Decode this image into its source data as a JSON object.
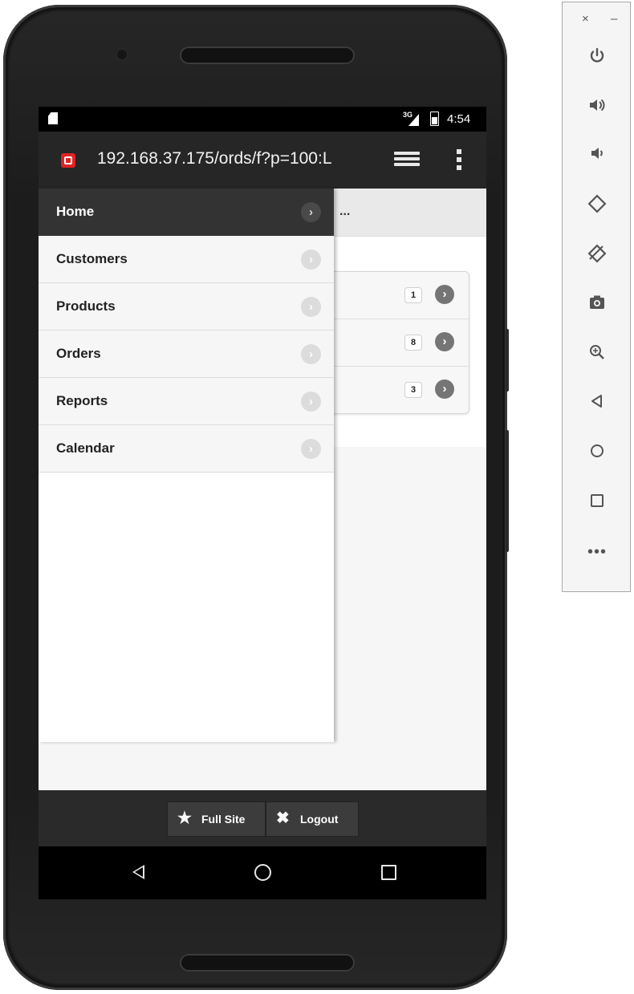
{
  "status_bar": {
    "network": "3G",
    "time": "4:54"
  },
  "browser": {
    "url": "192.168.37.175/ords/f?p=100:L"
  },
  "page": {
    "title_fragment": "..."
  },
  "list_counts": [
    "1",
    "8",
    "3"
  ],
  "nav_menu": [
    {
      "label": "Home",
      "active": true
    },
    {
      "label": "Customers",
      "active": false
    },
    {
      "label": "Products",
      "active": false
    },
    {
      "label": "Orders",
      "active": false
    },
    {
      "label": "Reports",
      "active": false
    },
    {
      "label": "Calendar",
      "active": false
    }
  ],
  "footer": {
    "full_site_label": "Full Site",
    "logout_label": "Logout"
  },
  "emulator_toolbar": {
    "close_glyph": "×",
    "minimize_glyph": "–",
    "tools": [
      "power-icon",
      "volume-up-icon",
      "volume-down-icon",
      "rotate-left-icon",
      "rotate-right-icon",
      "camera-icon",
      "zoom-icon",
      "back-icon",
      "home-icon",
      "overview-icon",
      "more-icon"
    ]
  },
  "colors": {
    "panel_active": "#333333",
    "url_bar": "#262626",
    "footer": "#2a2a2a",
    "site_icon": "#e02323"
  }
}
